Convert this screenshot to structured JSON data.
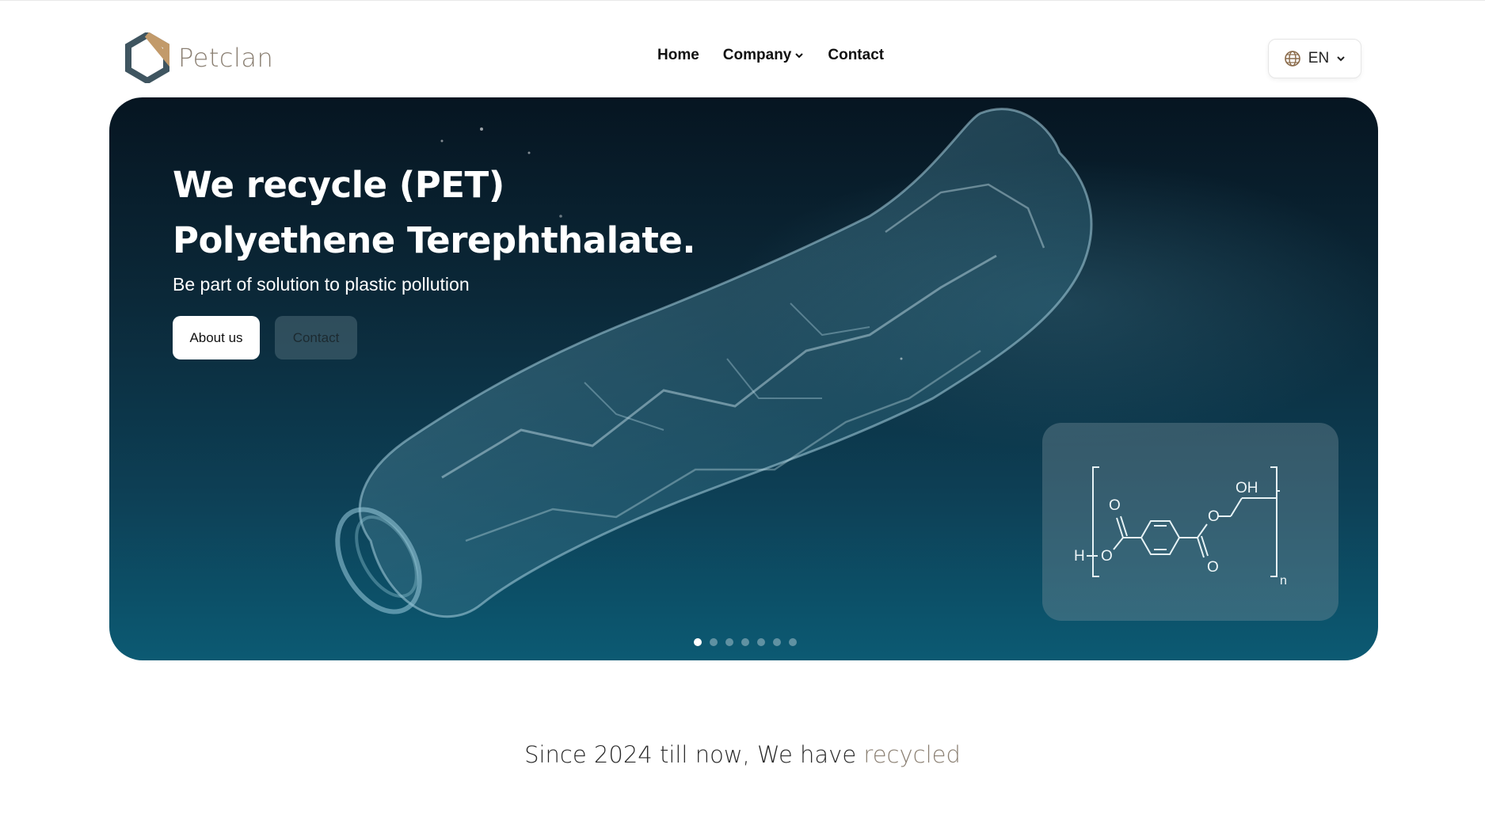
{
  "brand": {
    "name": "Petclan"
  },
  "nav": {
    "items": [
      {
        "label": "Home",
        "has_dropdown": false
      },
      {
        "label": "Company",
        "has_dropdown": true
      },
      {
        "label": "Contact",
        "has_dropdown": false
      }
    ]
  },
  "language": {
    "label": "EN",
    "icon": "globe-icon"
  },
  "hero": {
    "title_line1": "We recycle (PET)",
    "title_line2": "Polyethene Terephthalate.",
    "subtitle": "Be part of solution to plastic pollution",
    "buttons": {
      "about": "About us",
      "contact": "Contact"
    },
    "slide_count": 7,
    "active_slide": 0,
    "formula": {
      "oh": "OH",
      "o_top_left": "O",
      "o_top_right": "O",
      "o_bottom_left": "O",
      "o_bottom_right": "O",
      "h": "H",
      "n": "n"
    }
  },
  "stats": {
    "text": "Since 2024 till now, We have",
    "accent": "recycled"
  },
  "colors": {
    "accent": "#8a7f72",
    "hero_dark": "#061521",
    "hero_teal": "#0c5a73"
  }
}
